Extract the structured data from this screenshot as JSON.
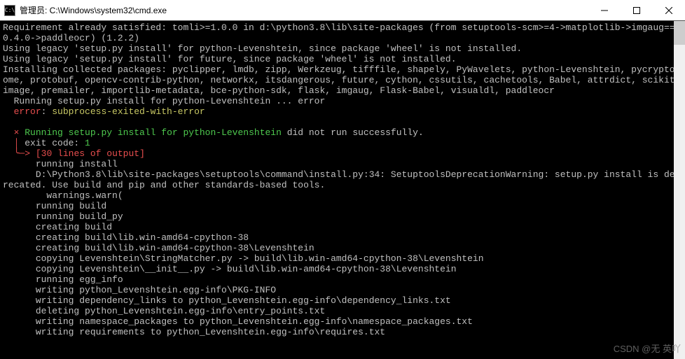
{
  "window": {
    "icon_text": "C:\\",
    "title": "管理员: C:\\Windows\\system32\\cmd.exe"
  },
  "lines": [
    {
      "segs": [
        {
          "t": "Requirement already satisfied: tomli>=1.0.0 in d:\\python3.8\\lib\\site-packages (from setuptools-scm>=4->matplotlib->imgaug==0.4.0->paddleocr) (1.2.2)"
        }
      ]
    },
    {
      "segs": [
        {
          "t": "Using legacy 'setup.py install' for python-Levenshtein, since package 'wheel' is not installed."
        }
      ]
    },
    {
      "segs": [
        {
          "t": "Using legacy 'setup.py install' for future, since package 'wheel' is not installed."
        }
      ]
    },
    {
      "segs": [
        {
          "t": "Installing collected packages: pyclipper, lmdb, zipp, Werkzeug, tifffile, shapely, PyWavelets, python-Levenshtein, pycryptodome, protobuf, opencv-contrib-python, networkx, itsdangerous, future, cython, cssutils, cachetools, Babel, attrdict, scikit-image, premailer, importlib-metadata, bce-python-sdk, flask, imgaug, Flask-Babel, visualdl, paddleocr"
        }
      ]
    },
    {
      "segs": [
        {
          "t": "  Running setup.py install for python-Levenshtein ... error"
        }
      ]
    },
    {
      "segs": [
        {
          "t": "  ",
          "c": ""
        },
        {
          "t": "error",
          "c": "red"
        },
        {
          "t": ": "
        },
        {
          "t": "subprocess-exited-with-error",
          "c": "yellow"
        }
      ]
    },
    {
      "segs": [
        {
          "t": " "
        }
      ]
    },
    {
      "segs": [
        {
          "t": "  ",
          "c": ""
        },
        {
          "t": "×",
          "c": "red"
        },
        {
          "t": " "
        },
        {
          "t": "Running setup.py install for python-Levenshtein",
          "c": "green"
        },
        {
          "t": " did not run successfully."
        }
      ]
    },
    {
      "segs": [
        {
          "t": "  ",
          "c": ""
        },
        {
          "t": "│",
          "c": "red"
        },
        {
          "t": " exit code: "
        },
        {
          "t": "1",
          "c": "green"
        }
      ]
    },
    {
      "segs": [
        {
          "t": "  ",
          "c": ""
        },
        {
          "t": "╰─>",
          "c": "red"
        },
        {
          "t": " "
        },
        {
          "t": "[30 lines of output]",
          "c": "red"
        }
      ]
    },
    {
      "segs": [
        {
          "t": "      running install"
        }
      ]
    },
    {
      "segs": [
        {
          "t": "      D:\\Python3.8\\lib\\site-packages\\setuptools\\command\\install.py:34: SetuptoolsDeprecationWarning: setup.py install is deprecated. Use build and pip and other standards-based tools."
        }
      ]
    },
    {
      "segs": [
        {
          "t": "        warnings.warn("
        }
      ]
    },
    {
      "segs": [
        {
          "t": "      running build"
        }
      ]
    },
    {
      "segs": [
        {
          "t": "      running build_py"
        }
      ]
    },
    {
      "segs": [
        {
          "t": "      creating build"
        }
      ]
    },
    {
      "segs": [
        {
          "t": "      creating build\\lib.win-amd64-cpython-38"
        }
      ]
    },
    {
      "segs": [
        {
          "t": "      creating build\\lib.win-amd64-cpython-38\\Levenshtein"
        }
      ]
    },
    {
      "segs": [
        {
          "t": "      copying Levenshtein\\StringMatcher.py -> build\\lib.win-amd64-cpython-38\\Levenshtein"
        }
      ]
    },
    {
      "segs": [
        {
          "t": "      copying Levenshtein\\__init__.py -> build\\lib.win-amd64-cpython-38\\Levenshtein"
        }
      ]
    },
    {
      "segs": [
        {
          "t": "      running egg_info"
        }
      ]
    },
    {
      "segs": [
        {
          "t": "      writing python_Levenshtein.egg-info\\PKG-INFO"
        }
      ]
    },
    {
      "segs": [
        {
          "t": "      writing dependency_links to python_Levenshtein.egg-info\\dependency_links.txt"
        }
      ]
    },
    {
      "segs": [
        {
          "t": "      deleting python_Levenshtein.egg-info\\entry_points.txt"
        }
      ]
    },
    {
      "segs": [
        {
          "t": "      writing namespace_packages to python_Levenshtein.egg-info\\namespace_packages.txt"
        }
      ]
    },
    {
      "segs": [
        {
          "t": "      writing requirements to python_Levenshtein.egg-info\\requires.txt"
        }
      ]
    }
  ],
  "watermark": "CSDN @无 英吖"
}
